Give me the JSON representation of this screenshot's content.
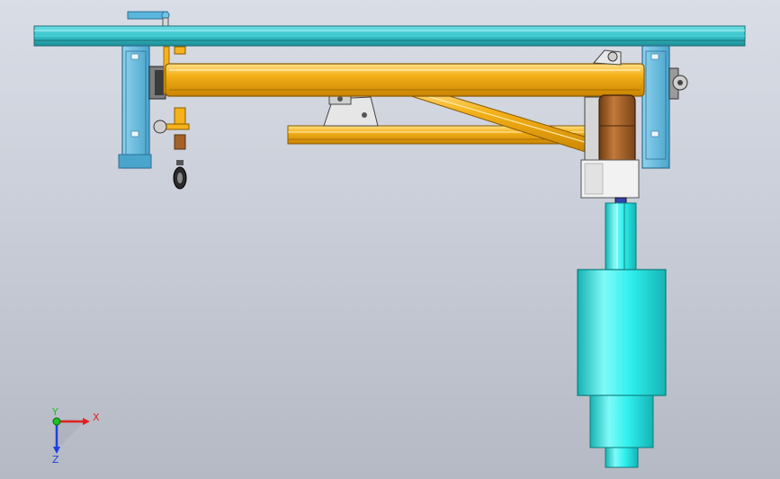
{
  "viewport": {
    "background_top": "#d9dde6",
    "background_bottom": "#b4b9c3"
  },
  "colors": {
    "rail": "#35c2c9",
    "rail_dark": "#1e8e96",
    "bracket": "#5ab6dc",
    "bracket_dark": "#2f6f94",
    "beam": "#f5b21a",
    "beam_dark": "#c98400",
    "beam_light": "#ffe08a",
    "pulley": "#a4622a",
    "cylinder": "#2ef0ee",
    "cylinder_dark": "#16b3b3",
    "housing": "#f2f2f2",
    "axis_x": "#e02020",
    "axis_y": "#20c020",
    "axis_z": "#2040e0"
  },
  "triad": {
    "x_label": "X",
    "y_label": "Y",
    "z_label": "Z"
  }
}
